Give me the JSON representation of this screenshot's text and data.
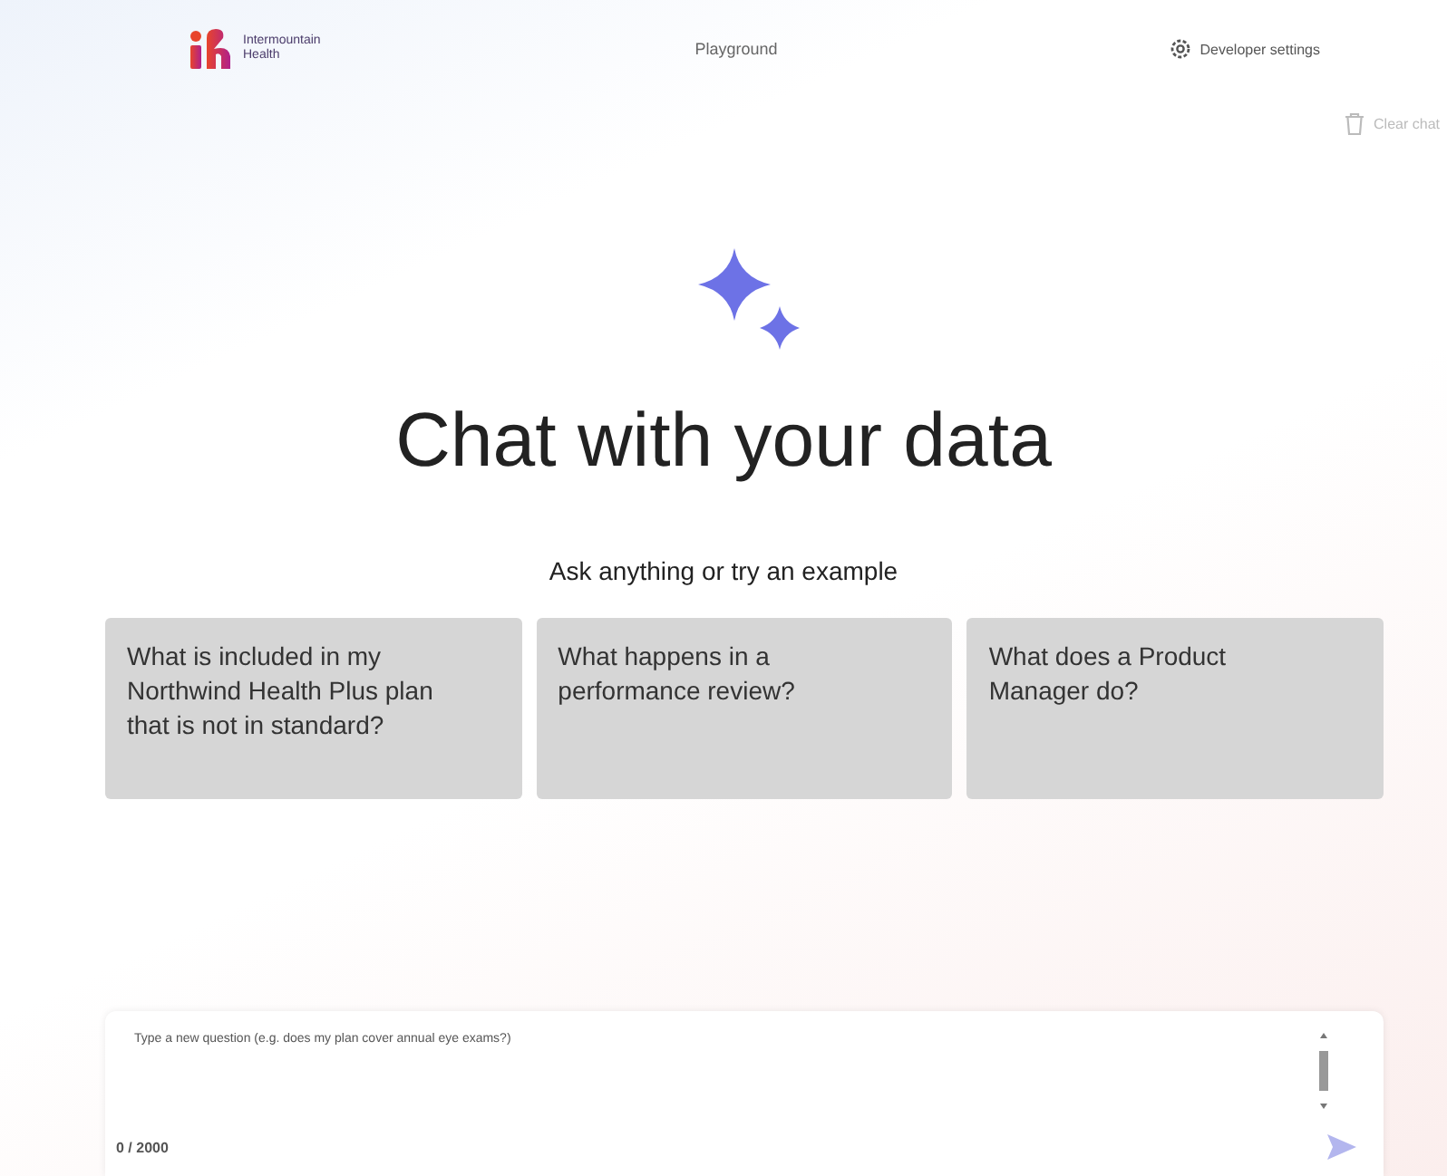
{
  "header": {
    "logo_text": [
      "Intermountain",
      "Health"
    ],
    "nav": "Playground",
    "settings": "Developer settings"
  },
  "clear_chat": {
    "label": "Clear chat",
    "disabled": true
  },
  "title": "Chat with your data",
  "subtitle": "Ask anything or try an example",
  "examples": [
    "What is included in my Northwind Health Plus plan that is not in standard?",
    "What happens in a performance review?",
    "What does a Product Manager do?"
  ],
  "input": {
    "placeholder": "Type a new question (e.g. does my plan cover annual eye exams?)",
    "counter": "0 / 2000"
  }
}
